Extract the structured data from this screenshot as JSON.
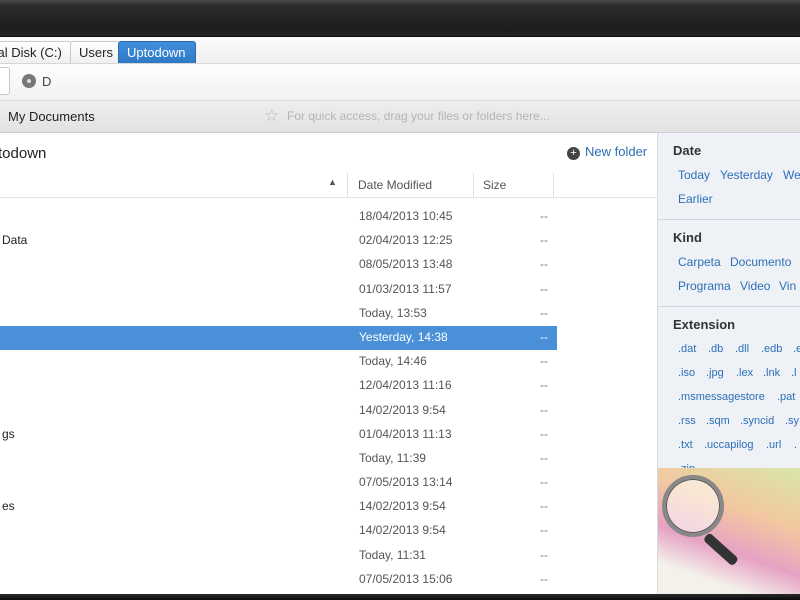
{
  "breadcrumb": [
    "cal Disk (C:)",
    "Users",
    "Uptodown"
  ],
  "toolbar": {
    "drive_label": "D"
  },
  "quick_access": {
    "item": "My Documents",
    "hint": "For quick access, drag your files or folders here..."
  },
  "folder": {
    "title": "todown",
    "new_folder_label": "New folder"
  },
  "columns": {
    "date": "Date Modified",
    "size": "Size"
  },
  "rows": [
    {
      "name": "",
      "date": "18/04/2013 10:45",
      "size": "--"
    },
    {
      "name": "Data",
      "date": "02/04/2013 12:25",
      "size": "--"
    },
    {
      "name": "",
      "date": "08/05/2013 13:48",
      "size": "--"
    },
    {
      "name": "",
      "date": "01/03/2013 11:57",
      "size": "--"
    },
    {
      "name": "",
      "date": "Today, 13:53",
      "size": "--"
    },
    {
      "name": "",
      "date": "Yesterday, 14:38",
      "size": "--"
    },
    {
      "name": "",
      "date": "Today, 14:46",
      "size": "--"
    },
    {
      "name": "",
      "date": "12/04/2013 11:16",
      "size": "--"
    },
    {
      "name": "",
      "date": "14/02/2013 9:54",
      "size": "--"
    },
    {
      "name": "gs",
      "date": "01/04/2013 11:13",
      "size": "--"
    },
    {
      "name": "",
      "date": "Today, 11:39",
      "size": "--"
    },
    {
      "name": "",
      "date": "07/05/2013 13:14",
      "size": "--"
    },
    {
      "name": "es",
      "date": "14/02/2013 9:54",
      "size": "--"
    },
    {
      "name": "",
      "date": "14/02/2013 9:54",
      "size": "--"
    },
    {
      "name": "",
      "date": "Today, 11:31",
      "size": "--"
    },
    {
      "name": "",
      "date": "07/05/2013 15:06",
      "size": "--"
    }
  ],
  "filters": {
    "date": {
      "title": "Date",
      "items": [
        "Today",
        "Yesterday",
        "We",
        "Earlier"
      ]
    },
    "kind": {
      "title": "Kind",
      "items": [
        "Carpeta",
        "Documento",
        "Programa",
        "Video",
        "Vin"
      ]
    },
    "extension": {
      "title": "Extension",
      "items": [
        ".dat",
        ".db",
        ".dll",
        ".edb",
        ".e",
        ".iso",
        ".jpg",
        ".lex",
        ".lnk",
        ".l",
        ".msmessagestore",
        ".pat",
        ".rss",
        ".sqm",
        ".syncid",
        ".sy",
        ".txt",
        ".uccapilog",
        ".url",
        ".",
        ".zip"
      ]
    }
  },
  "colors": {
    "accent": "#4a90d9",
    "link": "#2d6fb7",
    "panel_bg": "#eef2f7"
  }
}
